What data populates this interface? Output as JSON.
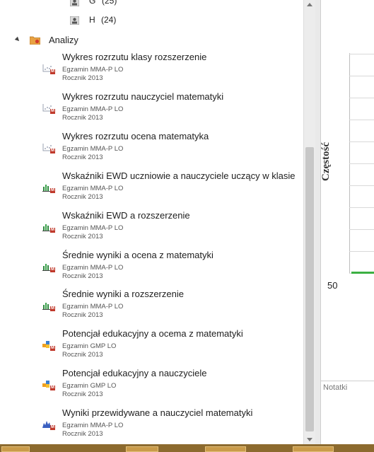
{
  "tree": {
    "group_g_label": "G",
    "group_g_count": "(25)",
    "group_h_label": "H",
    "group_h_count": "(24)",
    "folder_label": "Analizy",
    "items": [
      {
        "title": "Wykres rozrzutu klasy rozszerzenie",
        "exam": "Egzamin MMA-P  LO",
        "year": "Rocznik 2013",
        "icon": "scatter-chart-icon"
      },
      {
        "title": "Wykres rozrzutu nauczyciel matematyki",
        "exam": "Egzamin MMA-P  LO",
        "year": "Rocznik 2013",
        "icon": "scatter-chart-icon"
      },
      {
        "title": "Wykres rozrzutu ocena matematyka",
        "exam": "Egzamin MMA-P  LO",
        "year": "Rocznik 2013",
        "icon": "scatter-chart-icon"
      },
      {
        "title": "Wskaźniki EWD uczniowie a nauczyciele uczący w klasie",
        "exam": "Egzamin MMA-P  LO",
        "year": "Rocznik 2013",
        "icon": "bar-chart-icon"
      },
      {
        "title": "Wskaźniki EWD a rozszerzenie",
        "exam": "Egzamin MMA-P  LO",
        "year": "Rocznik 2013",
        "icon": "bar-chart-icon"
      },
      {
        "title": "Średnie wyniki a ocena z matematyki",
        "exam": "Egzamin MMA-P  LO",
        "year": "Rocznik 2013",
        "icon": "bar-chart-icon"
      },
      {
        "title": "Średnie wyniki a rozszerzenie",
        "exam": "Egzamin MMA-P  LO",
        "year": "Rocznik 2013",
        "icon": "bar-chart-icon"
      },
      {
        "title": "Potencjał edukacyjny a ocema z matematyki",
        "exam": "Egzamin GMP  LO",
        "year": "Rocznik 2013",
        "icon": "blocks-chart-icon"
      },
      {
        "title": "Potencjał edukacyjny a nauczyciele",
        "exam": "Egzamin GMP  LO",
        "year": "Rocznik 2013",
        "icon": "blocks-chart-icon"
      },
      {
        "title": "Wyniki przewidywane a nauczyciel matematyki",
        "exam": "Egzamin MMA-P  LO",
        "year": "Rocznik 2013",
        "icon": "prediction-chart-icon"
      }
    ]
  },
  "preview": {
    "y_axis_label": "Częstość",
    "x_tick_first": "50",
    "notes_label": "Notatki",
    "line_color": "#3cb043"
  }
}
